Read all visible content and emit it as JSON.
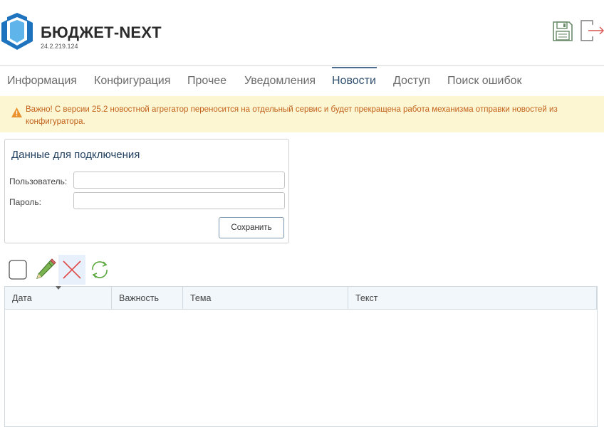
{
  "header": {
    "title": "БЮДЖЕТ-NEXT",
    "version": "24.2.219.124",
    "icons": [
      "save-icon",
      "exit-icon"
    ],
    "brand_color": "#1e73be"
  },
  "tabs": [
    {
      "label": "Информация",
      "active": false
    },
    {
      "label": "Конфигурация",
      "active": false
    },
    {
      "label": "Прочее",
      "active": false
    },
    {
      "label": "Уведомления",
      "active": false
    },
    {
      "label": "Новости",
      "active": true
    },
    {
      "label": "Доступ",
      "active": false
    },
    {
      "label": "Поиск ошибок",
      "active": false
    }
  ],
  "warning": {
    "text": "Важно! С версии 25.2 новостной агрегатор переносится на отдельный сервис и будет прекращена работа механизма отправки новостей из конфигуратора.",
    "color": "#c2621a",
    "background": "#fdf6d3"
  },
  "connection": {
    "title": "Данные для подключения",
    "user_label": "Пользователь:",
    "user_value": "",
    "password_label": "Пароль:",
    "password_value": "",
    "save_label": "Сохранить"
  },
  "toolbar": {
    "icons": [
      "checkbox-icon",
      "edit-pencil-icon",
      "delete-cross-icon",
      "refresh-icon"
    ]
  },
  "grid": {
    "columns": [
      "Дата",
      "Важность",
      "Тема",
      "Текст"
    ],
    "sorted_column": "Дата",
    "rows": []
  }
}
